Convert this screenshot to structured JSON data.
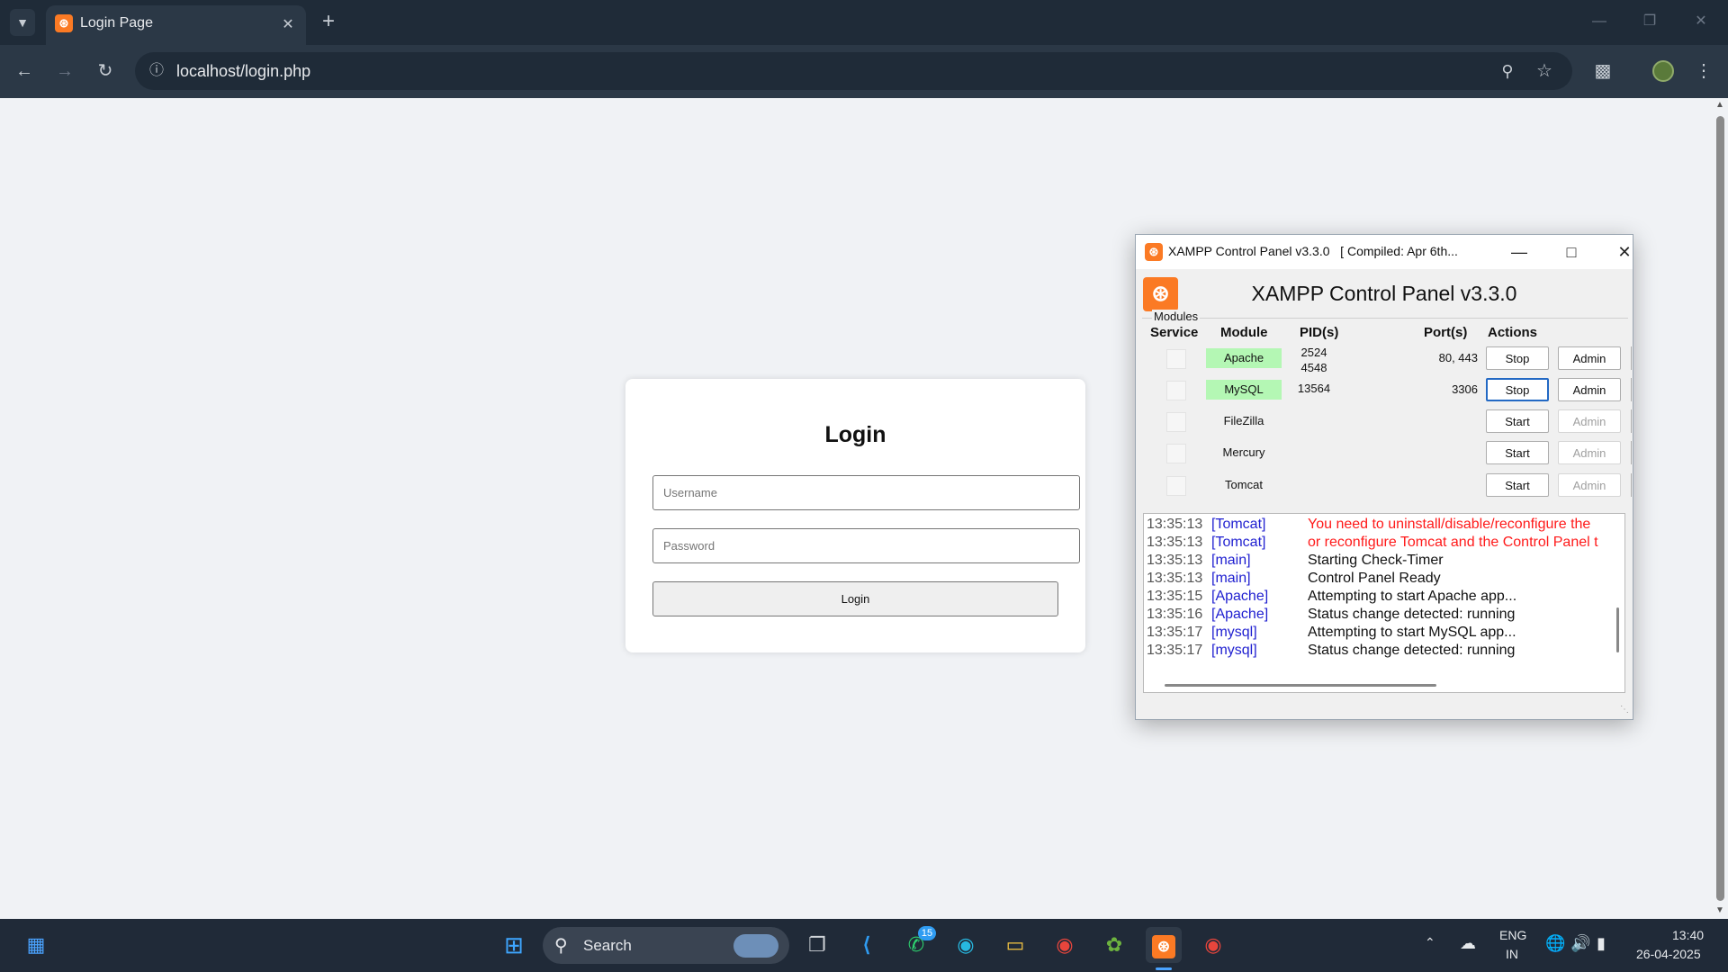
{
  "browser": {
    "tab_title": "Login Page",
    "new_tab": "+",
    "url": "localhost/login.php",
    "icons": [
      "tab-search-icon",
      "close-icon",
      "new-tab-icon",
      "minimize-icon",
      "restore-icon",
      "back-icon",
      "forward-icon",
      "reload-icon",
      "site-info-icon",
      "zoom-icon",
      "bookmark-star-icon",
      "extensions-icon",
      "profile-avatar",
      "menu-icon"
    ]
  },
  "login": {
    "title": "Login",
    "username_placeholder": "Username",
    "password_placeholder": "Password",
    "button_label": "Login"
  },
  "xampp": {
    "window_title": "XAMPP Control Panel v3.3.0   [ Compiled: Apr 6th...",
    "heading": "XAMPP Control Panel v3.3.0",
    "modules_label": "Modules",
    "headers": {
      "service": "Service",
      "module": "Module",
      "pids": "PID(s)",
      "ports": "Port(s)",
      "actions": "Actions"
    },
    "rows": [
      {
        "module": "Apache",
        "pid1": "2524",
        "pid2": "4548",
        "ports": "80, 443",
        "action": "Stop",
        "admin": "Admin",
        "running": true
      },
      {
        "module": "MySQL",
        "pid1": "13564",
        "pid2": "",
        "ports": "3306",
        "action": "Stop",
        "admin": "Admin",
        "running": true
      },
      {
        "module": "FileZilla",
        "pid1": "",
        "pid2": "",
        "ports": "",
        "action": "Start",
        "admin": "Admin",
        "running": false
      },
      {
        "module": "Mercury",
        "pid1": "",
        "pid2": "",
        "ports": "",
        "action": "Start",
        "admin": "Admin",
        "running": false
      },
      {
        "module": "Tomcat",
        "pid1": "",
        "pid2": "",
        "ports": "",
        "action": "Start",
        "admin": "Admin",
        "running": false
      }
    ],
    "log": [
      {
        "time": "13:35:13",
        "module": "[Tomcat]",
        "message": "You need to uninstall/disable/reconfigure the",
        "error": true
      },
      {
        "time": "13:35:13",
        "module": "[Tomcat]",
        "message": "or reconfigure Tomcat and the Control Panel t",
        "error": true
      },
      {
        "time": "13:35:13",
        "module": "[main]",
        "message": "Starting Check-Timer",
        "error": false
      },
      {
        "time": "13:35:13",
        "module": "[main]",
        "message": "Control Panel Ready",
        "error": false
      },
      {
        "time": "13:35:15",
        "module": "[Apache]",
        "message": "Attempting to start Apache app...",
        "error": false
      },
      {
        "time": "13:35:16",
        "module": "[Apache]",
        "message": "Status change detected: running",
        "error": false
      },
      {
        "time": "13:35:17",
        "module": "[mysql]",
        "message": "Attempting to start MySQL app...",
        "error": false
      },
      {
        "time": "13:35:17",
        "module": "[mysql]",
        "message": "Status change detected: running",
        "error": false
      }
    ],
    "colors": {
      "running": "#b4f7b4",
      "error": "#ff1a1a",
      "module_tag": "#1f1fd0",
      "brand": "#fb7a24"
    }
  },
  "taskbar": {
    "search_label": "Search",
    "whatsapp_badge": "15",
    "lang": "ENG",
    "region": "IN",
    "time": "13:40",
    "date": "26-04-2025"
  }
}
